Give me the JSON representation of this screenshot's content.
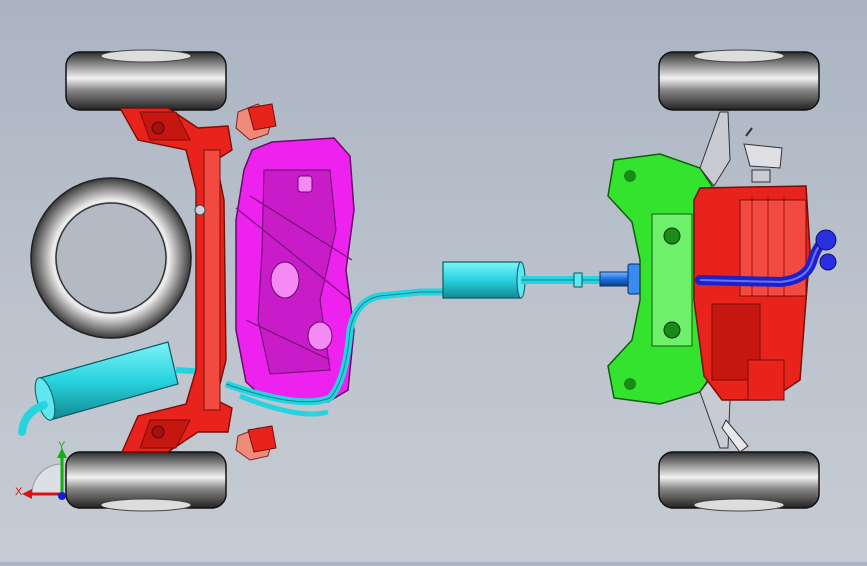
{
  "viewport": {
    "background_top": "#aab4c2",
    "background_bottom": "#c7ccd3"
  },
  "model": {
    "colors": {
      "front_subframe": "#e8231c",
      "front_subframe_dark": "#a3110c",
      "fuel_tank": "#ee22ee",
      "fuel_tank_dark": "#9a1c9a",
      "exhaust": "#27d3df",
      "exhaust_dark": "#128892",
      "rear_subframe": "#34e32e",
      "rear_subframe_dark": "#1a8a18",
      "rear_motor": "#e8231c",
      "driveshaft": "#1a6de0",
      "coolant_hose": "#1c22c8",
      "tire": "#3a3a3a",
      "spare_tire": "#8c8c8c",
      "bracket": "#f08a7a"
    },
    "parts": [
      "front-subframe",
      "fuel-tank",
      "exhaust-system",
      "muffler",
      "spare-tire",
      "driveshaft",
      "rear-subframe",
      "rear-drive-unit",
      "wheels"
    ]
  },
  "triad": {
    "x_label": "X",
    "y_label": "Y",
    "x_color": "#e01010",
    "y_color": "#10b010",
    "z_color": "#1020e0"
  }
}
